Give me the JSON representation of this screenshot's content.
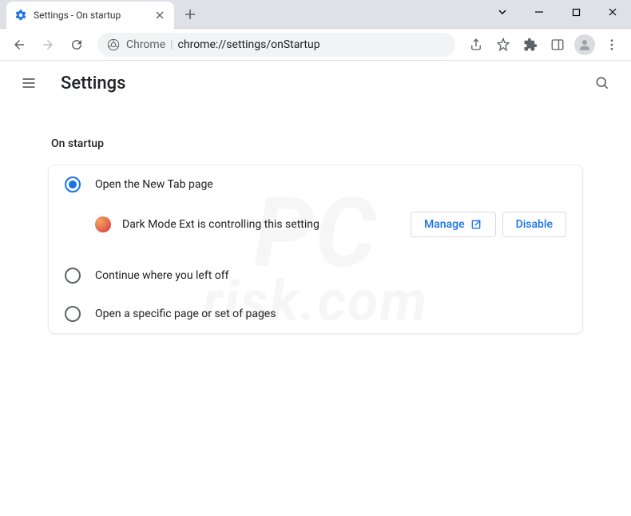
{
  "window": {
    "tab_title": "Settings - On startup"
  },
  "omnibox": {
    "origin": "Chrome",
    "path": "chrome://settings/onStartup"
  },
  "header": {
    "title": "Settings"
  },
  "section": {
    "title": "On startup"
  },
  "options": [
    {
      "label": "Open the New Tab page",
      "selected": true
    },
    {
      "label": "Continue where you left off",
      "selected": false
    },
    {
      "label": "Open a specific page or set of pages",
      "selected": false
    }
  ],
  "controlled": {
    "text": "Dark Mode Ext is controlling this setting",
    "manage_label": "Manage",
    "disable_label": "Disable"
  },
  "watermark": {
    "line1": "PC",
    "line2": "risk.com"
  }
}
